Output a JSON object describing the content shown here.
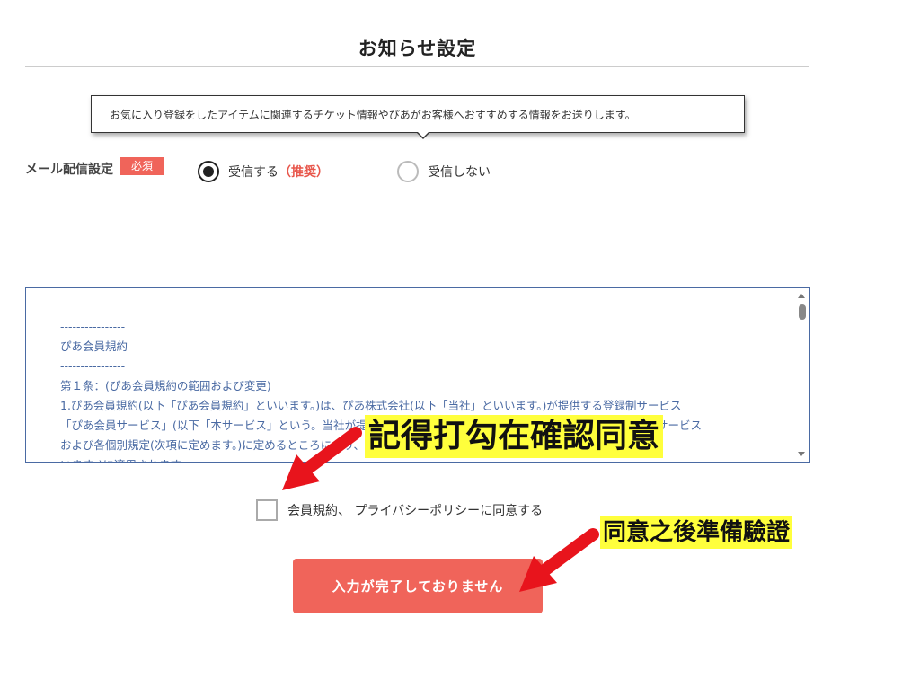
{
  "page": {
    "title": "お知らせ設定"
  },
  "tooltip": {
    "text": "お気に入り登録をしたアイテムに関連するチケット情報やぴあがお客様へおすすめする情報をお送りします。"
  },
  "mail_setting": {
    "label": "メール配信設定",
    "required_badge": "必須",
    "options": [
      {
        "label": "受信する",
        "note": "（推奨）",
        "selected": true
      },
      {
        "label": "受信しない",
        "selected": false
      }
    ]
  },
  "terms": {
    "lines": [
      "----------------",
      "ぴあ会員規約",
      "----------------",
      "第１条：(ぴあ会員規約の範囲および変更)",
      "1.ぴあ会員規約(以下「ぴあ会員規約」といいます。)は、ぴあ株式会社(以下「当社」といいます。)が提供する登録制サービス",
      "「ぴあ会員サービス」(以下「本サービス」という。当社が提供するサービスの総称をいいます。)に関し当社が提供するサービス",
      "および各個別規定(次項に定めます。)に定めるところにより、本サービスを利用する者(以下「会員」とい",
      "います。)に適用されます。"
    ]
  },
  "agreement": {
    "prefix": "会員規約、",
    "link": "プライバシーポリシー",
    "suffix": "に同意する",
    "checked": false
  },
  "submit": {
    "label": "入力が完了しておりません"
  },
  "annotations": {
    "check_reminder": "記得打勾在確認同意",
    "after_agree": "同意之後準備驗證"
  },
  "colors": {
    "accent": "#f0645a",
    "highlight": "#ffff3c",
    "arrow": "#e8141c",
    "terms_text": "#4a6aa3"
  }
}
